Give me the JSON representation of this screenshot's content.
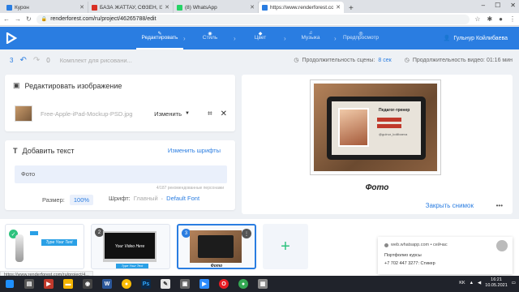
{
  "browser": {
    "tabs": [
      {
        "label": "Курон",
        "color": "#2a7de1",
        "active": false
      },
      {
        "label": "БАЗА ЖАТТАУ, СӨЗЕН, ІЗБУРЈС...",
        "color": "#d93025",
        "active": false
      },
      {
        "label": "(8) WhatsApp",
        "color": "#25d366",
        "active": false
      },
      {
        "label": "https://www.renderforest.com/r...",
        "color": "#2a7de1",
        "active": true
      }
    ],
    "url": "renderforest.com/ru/project/46265788/edit"
  },
  "app": {
    "steps": [
      {
        "label": "Редактировать",
        "icon": "pencil-icon",
        "active": true
      },
      {
        "label": "Стиль",
        "icon": "palette-icon",
        "active": false
      },
      {
        "label": "Цвет",
        "icon": "droplet-icon",
        "active": false
      },
      {
        "label": "Музыка",
        "icon": "music-icon",
        "active": false
      },
      {
        "label": "Предпросмотр",
        "icon": "eye-icon",
        "active": false
      }
    ],
    "user": "Гульнур Койлибаева",
    "accent": "#2a7de1"
  },
  "toolbar": {
    "undo_count": "3",
    "redo_count": "0",
    "comment_placeholder": "Комплект для рисовани...",
    "scene_duration_label": "Продолжительность сцены:",
    "scene_duration_value": "8 сек",
    "video_duration_label": "Продолжительность видео: 01:16 мин"
  },
  "image_card": {
    "title": "Редактировать изображение",
    "filename": "Free-Apple-iPad-Mockup-PSD.jpg",
    "change_label": "Изменить"
  },
  "text_card": {
    "title": "Добавить текст",
    "change_fonts": "Изменить шрифты",
    "text_value": "Фото",
    "hint": "4/187 рекомендованные персонажи",
    "size_label": "Размер:",
    "size_value": "100%",
    "font_label": "Шрифт:",
    "font_main": "Главный",
    "font_value": "Default Font"
  },
  "preview": {
    "caption": "Фото",
    "screen_title": "Педагог-тренер",
    "screen_caption": "@gulnur_koilibaeva",
    "snapshot": "Закрыть снимок"
  },
  "timeline": {
    "slides": [
      {
        "number": "",
        "text": "Type Your Text"
      },
      {
        "number": "2",
        "text": "Your Video Here",
        "text2": "Type Your Text"
      },
      {
        "number": "3",
        "text": "Фото"
      }
    ]
  },
  "notification": {
    "source": "web.whatsapp.com • сейчас",
    "line1": "Портфолио курсы",
    "line2": "+7 702 447 3277: Стикер"
  },
  "status_url": "https://www.renderforest.com/ru/project/4...",
  "taskbar": {
    "lang": "KK",
    "time": "16:21",
    "date": "10.05.2021"
  }
}
